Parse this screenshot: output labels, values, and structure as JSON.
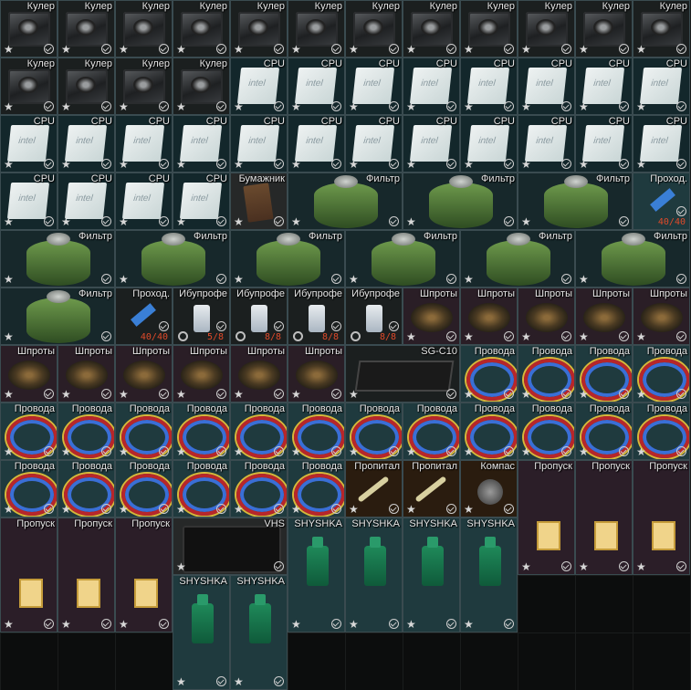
{
  "inventory": {
    "title": "",
    "items": [
      {
        "label": "Кулер",
        "kind": "cooler"
      },
      {
        "label": "Кулер",
        "kind": "cooler"
      },
      {
        "label": "Кулер",
        "kind": "cooler"
      },
      {
        "label": "Кулер",
        "kind": "cooler"
      },
      {
        "label": "Кулер",
        "kind": "cooler"
      },
      {
        "label": "Кулер",
        "kind": "cooler"
      },
      {
        "label": "Кулер",
        "kind": "cooler"
      },
      {
        "label": "Кулер",
        "kind": "cooler"
      },
      {
        "label": "Кулер",
        "kind": "cooler"
      },
      {
        "label": "Кулер",
        "kind": "cooler"
      },
      {
        "label": "Кулер",
        "kind": "cooler"
      },
      {
        "label": "Кулер",
        "kind": "cooler"
      },
      {
        "label": "Кулер",
        "kind": "cooler"
      },
      {
        "label": "Кулер",
        "kind": "cooler"
      },
      {
        "label": "Кулер",
        "kind": "cooler"
      },
      {
        "label": "Кулер",
        "kind": "cooler"
      },
      {
        "label": "CPU",
        "kind": "cpu"
      },
      {
        "label": "CPU",
        "kind": "cpu"
      },
      {
        "label": "CPU",
        "kind": "cpu"
      },
      {
        "label": "CPU",
        "kind": "cpu"
      },
      {
        "label": "CPU",
        "kind": "cpu"
      },
      {
        "label": "CPU",
        "kind": "cpu"
      },
      {
        "label": "CPU",
        "kind": "cpu"
      },
      {
        "label": "CPU",
        "kind": "cpu"
      },
      {
        "label": "CPU",
        "kind": "cpu"
      },
      {
        "label": "CPU",
        "kind": "cpu"
      },
      {
        "label": "CPU",
        "kind": "cpu"
      },
      {
        "label": "CPU",
        "kind": "cpu"
      },
      {
        "label": "CPU",
        "kind": "cpu"
      },
      {
        "label": "CPU",
        "kind": "cpu"
      },
      {
        "label": "CPU",
        "kind": "cpu"
      },
      {
        "label": "CPU",
        "kind": "cpu"
      },
      {
        "label": "CPU",
        "kind": "cpu"
      },
      {
        "label": "CPU",
        "kind": "cpu"
      },
      {
        "label": "CPU",
        "kind": "cpu"
      },
      {
        "label": "CPU",
        "kind": "cpu"
      },
      {
        "label": "CPU",
        "kind": "cpu"
      },
      {
        "label": "CPU",
        "kind": "cpu"
      },
      {
        "label": "CPU",
        "kind": "cpu"
      },
      {
        "label": "CPU",
        "kind": "cpu"
      },
      {
        "label": "Бумажник",
        "kind": "wallet"
      },
      {
        "label": "Фильтр",
        "kind": "filter"
      },
      {
        "label": "Фильтр",
        "kind": "filter"
      },
      {
        "label": "Фильтр",
        "kind": "filter"
      },
      {
        "label": "Проход.",
        "kind": "key",
        "count": "40/40"
      },
      {
        "label": "Фильтр",
        "kind": "filter"
      },
      {
        "label": "Фильтр",
        "kind": "filter"
      },
      {
        "label": "Фильтр",
        "kind": "filter"
      },
      {
        "label": "Фильтр",
        "kind": "filter"
      },
      {
        "label": "Фильтр",
        "kind": "filter"
      },
      {
        "label": "Фильтр",
        "kind": "filter"
      },
      {
        "label": "Фильтр",
        "kind": "filter"
      },
      {
        "label": "Проход.",
        "kind": "key",
        "count": "40/40"
      },
      {
        "label": "Ибупрофе",
        "kind": "ibu",
        "count": "5/8"
      },
      {
        "label": "Ибупрофе",
        "kind": "ibu",
        "count": "8/8"
      },
      {
        "label": "Ибупрофе",
        "kind": "ibu",
        "count": "8/8"
      },
      {
        "label": "Ибупрофе",
        "kind": "ibu",
        "count": "8/8"
      },
      {
        "label": "Шпроты",
        "kind": "tin"
      },
      {
        "label": "Шпроты",
        "kind": "tin"
      },
      {
        "label": "Шпроты",
        "kind": "tin"
      },
      {
        "label": "Шпроты",
        "kind": "tin"
      },
      {
        "label": "Шпроты",
        "kind": "tin"
      },
      {
        "label": "Шпроты",
        "kind": "tin"
      },
      {
        "label": "Шпроты",
        "kind": "tin"
      },
      {
        "label": "Шпроты",
        "kind": "tin"
      },
      {
        "label": "Шпроты",
        "kind": "tin"
      },
      {
        "label": "Шпроты",
        "kind": "tin"
      },
      {
        "label": "Шпроты",
        "kind": "tin"
      },
      {
        "label": "SG-C10",
        "kind": "radio"
      },
      {
        "label": "Провода",
        "kind": "wire"
      },
      {
        "label": "Провода",
        "kind": "wire"
      },
      {
        "label": "Провода",
        "kind": "wire"
      },
      {
        "label": "Провода",
        "kind": "wire"
      },
      {
        "label": "Провода",
        "kind": "wire"
      },
      {
        "label": "Провода",
        "kind": "wire"
      },
      {
        "label": "Провода",
        "kind": "wire"
      },
      {
        "label": "Провода",
        "kind": "wire"
      },
      {
        "label": "Провода",
        "kind": "wire"
      },
      {
        "label": "Провода",
        "kind": "wire"
      },
      {
        "label": "Провода",
        "kind": "wire"
      },
      {
        "label": "Провода",
        "kind": "wire"
      },
      {
        "label": "Провода",
        "kind": "wire"
      },
      {
        "label": "Провода",
        "kind": "wire"
      },
      {
        "label": "Провода",
        "kind": "wire"
      },
      {
        "label": "Провода",
        "kind": "wire"
      },
      {
        "label": "Провода",
        "kind": "wire"
      },
      {
        "label": "Провода",
        "kind": "wire"
      },
      {
        "label": "Провода",
        "kind": "wire"
      },
      {
        "label": "Провода",
        "kind": "wire"
      },
      {
        "label": "Провода",
        "kind": "wire"
      },
      {
        "label": "Провода",
        "kind": "wire"
      },
      {
        "label": "Пропитал",
        "kind": "inject"
      },
      {
        "label": "Пропитал",
        "kind": "inject"
      },
      {
        "label": "Компас",
        "kind": "compass"
      },
      {
        "label": "Пропуск",
        "kind": "pass"
      },
      {
        "label": "Пропуск",
        "kind": "pass"
      },
      {
        "label": "Пропуск",
        "kind": "pass"
      },
      {
        "label": "Пропуск",
        "kind": "pass"
      },
      {
        "label": "Пропуск",
        "kind": "pass"
      },
      {
        "label": "Пропуск",
        "kind": "pass"
      },
      {
        "label": "VHS",
        "kind": "vhs"
      },
      {
        "label": "SHYSHKA",
        "kind": "bottle"
      },
      {
        "label": "SHYSHKA",
        "kind": "bottle"
      },
      {
        "label": "SHYSHKA",
        "kind": "bottle"
      },
      {
        "label": "SHYSHKA",
        "kind": "bottle"
      },
      {
        "label": "SHYSHKA",
        "kind": "bottle"
      },
      {
        "label": "SHYSHKA",
        "kind": "bottle"
      }
    ]
  },
  "colors": {
    "accent_count": "#e04a2a",
    "border": "#3a4b50"
  }
}
